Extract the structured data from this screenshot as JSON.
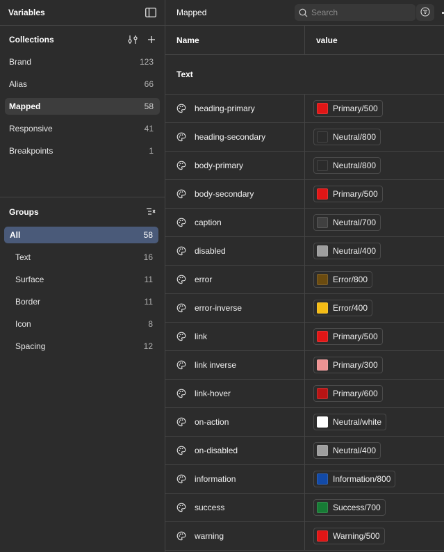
{
  "sidebar": {
    "title": "Variables",
    "collections": {
      "title": "Collections",
      "items": [
        {
          "label": "Brand",
          "count": "123"
        },
        {
          "label": "Alias",
          "count": "66"
        },
        {
          "label": "Mapped",
          "count": "58",
          "selected": true
        },
        {
          "label": "Responsive",
          "count": "41"
        },
        {
          "label": "Breakpoints",
          "count": "1"
        }
      ]
    },
    "groups": {
      "title": "Groups",
      "items": [
        {
          "label": "All",
          "count": "58",
          "selected": true
        },
        {
          "label": "Text",
          "count": "16"
        },
        {
          "label": "Surface",
          "count": "11"
        },
        {
          "label": "Border",
          "count": "11"
        },
        {
          "label": "Icon",
          "count": "8"
        },
        {
          "label": "Spacing",
          "count": "12"
        }
      ]
    }
  },
  "main": {
    "title": "Mapped",
    "search_placeholder": "Search",
    "columns": {
      "name": "Name",
      "value": "value"
    },
    "group_label": "Text",
    "rows": [
      {
        "name": "heading-primary",
        "value": "Primary/500",
        "color": "#e01616"
      },
      {
        "name": "heading-secondary",
        "value": "Neutral/800",
        "color": "#2b2b2b"
      },
      {
        "name": "body-primary",
        "value": "Neutral/800",
        "color": "#2b2b2b"
      },
      {
        "name": "body-secondary",
        "value": "Primary/500",
        "color": "#e01616"
      },
      {
        "name": "caption",
        "value": "Neutral/700",
        "color": "#404040"
      },
      {
        "name": "disabled",
        "value": "Neutral/400",
        "color": "#9e9e9e"
      },
      {
        "name": "error",
        "value": "Error/800",
        "color": "#6b4b0f"
      },
      {
        "name": "error-inverse",
        "value": "Error/400",
        "color": "#f5bc15"
      },
      {
        "name": "link",
        "value": "Primary/500",
        "color": "#e01616"
      },
      {
        "name": "link inverse",
        "value": "Primary/300",
        "color": "#ee9393"
      },
      {
        "name": "link-hover",
        "value": "Primary/600",
        "color": "#b81414"
      },
      {
        "name": "on-action",
        "value": "Neutral/white",
        "color": "#ffffff"
      },
      {
        "name": "on-disabled",
        "value": "Neutral/400",
        "color": "#9e9e9e"
      },
      {
        "name": "information",
        "value": "Information/800",
        "color": "#124aa8"
      },
      {
        "name": "success",
        "value": "Success/700",
        "color": "#177b35"
      },
      {
        "name": "warning",
        "value": "Warning/500",
        "color": "#e01616"
      }
    ]
  }
}
